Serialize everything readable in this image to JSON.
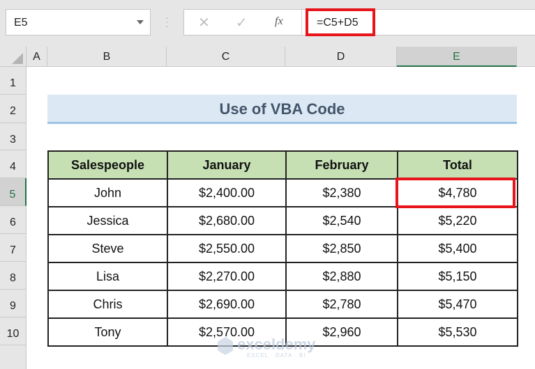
{
  "toolbar": {
    "name_box": "E5",
    "cancel_icon": "✕",
    "enter_icon": "✓",
    "fx_label": "fx",
    "formula": "=C5+D5"
  },
  "columns": [
    "A",
    "B",
    "C",
    "D",
    "E"
  ],
  "selected_column": "E",
  "rows": [
    "1",
    "2",
    "3",
    "4",
    "5",
    "6",
    "7",
    "8",
    "9",
    "10"
  ],
  "selected_row": "5",
  "sheet": {
    "title": "Use of VBA Code",
    "headers": [
      "Salespeople",
      "January",
      "February",
      "Total"
    ],
    "data": [
      [
        "John",
        "$2,400.00",
        "$2,380",
        "$4,780"
      ],
      [
        "Jessica",
        "$2,680.00",
        "$2,540",
        "$5,220"
      ],
      [
        "Steve",
        "$2,550.00",
        "$2,850",
        "$5,400"
      ],
      [
        "Lisa",
        "$2,270.00",
        "$2,880",
        "$5,150"
      ],
      [
        "Chris",
        "$2,690.00",
        "$2,780",
        "$5,470"
      ],
      [
        "Tony",
        "$2,570.00",
        "$2,960",
        "$5,530"
      ]
    ]
  },
  "watermark": {
    "name": "exceldemy",
    "tagline": "EXCEL · DATA · BI"
  },
  "colors": {
    "highlight": "#e8141b",
    "header_fill": "#c6e0b4",
    "title_fill": "#dce9f5",
    "selection_accent": "#217346"
  }
}
